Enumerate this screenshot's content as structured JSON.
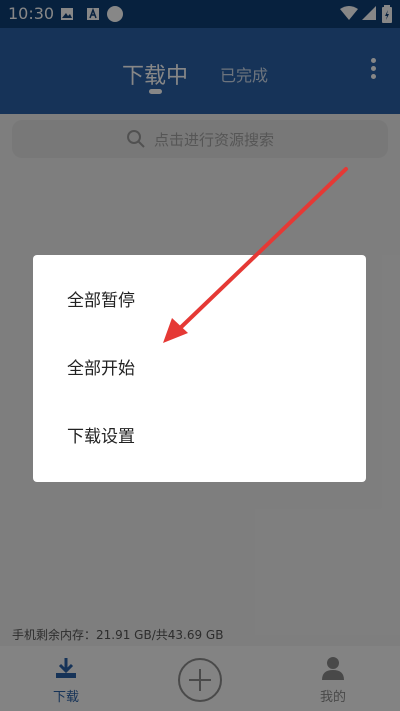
{
  "status_bar": {
    "time": "10:30",
    "icons": [
      "image-icon",
      "font-a-icon",
      "circle-icon",
      "wifi-icon",
      "cellular-icon",
      "battery-icon"
    ]
  },
  "header": {
    "tabs": [
      {
        "label": "下载中",
        "active": true
      },
      {
        "label": "已完成",
        "active": false
      }
    ],
    "more_icon": "more-vertical-icon"
  },
  "search": {
    "placeholder": "点击进行资源搜索",
    "icon": "search-icon"
  },
  "storage_info": "手机剩余内存：21.91 GB/共43.69 GB",
  "bottom_nav": {
    "items": [
      {
        "label": "下载",
        "icon": "download-icon",
        "active": true
      },
      {
        "label": "",
        "icon": "plus-circle-icon",
        "active": false
      },
      {
        "label": "我的",
        "icon": "person-icon",
        "active": false
      }
    ]
  },
  "dialog": {
    "items": [
      {
        "label": "全部暂停"
      },
      {
        "label": "全部开始"
      },
      {
        "label": "下载设置"
      }
    ]
  },
  "colors": {
    "status_bar": "#0f3f76",
    "app_bar": "#2a61a7",
    "annotation_arrow": "#e53935",
    "nav_active": "#2a61a7"
  }
}
